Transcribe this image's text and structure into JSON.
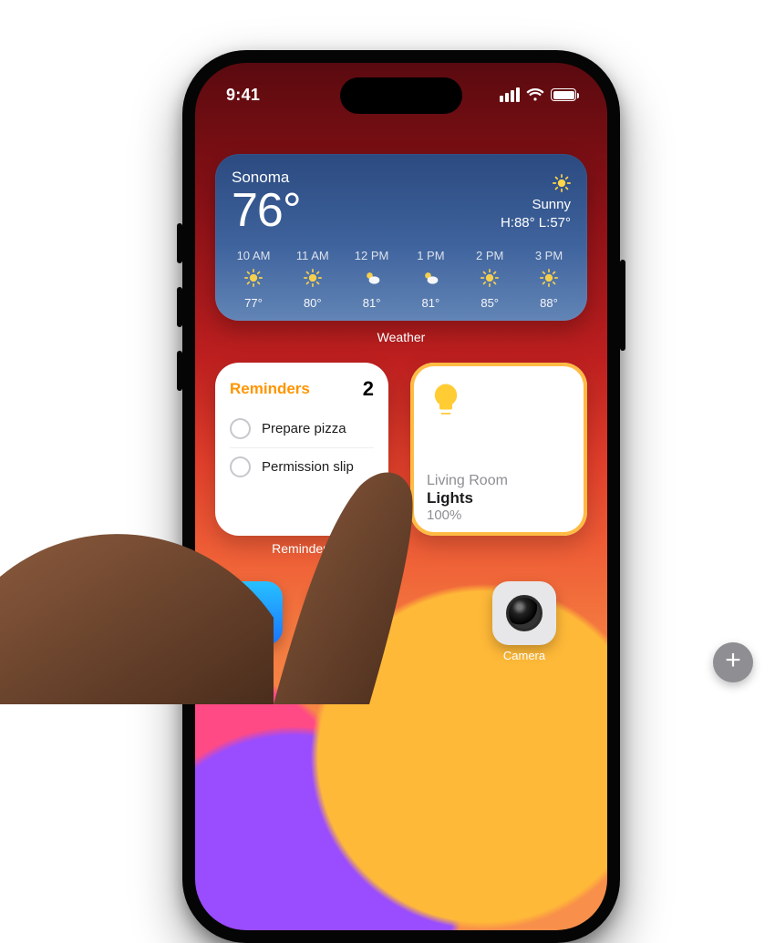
{
  "status": {
    "time": "9:41"
  },
  "weather": {
    "label": "Weather",
    "location": "Sonoma",
    "temp": "76°",
    "condition": "Sunny",
    "hilo": "H:88° L:57°",
    "hours": [
      {
        "t": "10 AM",
        "icon": "sun",
        "temp": "77°"
      },
      {
        "t": "11 AM",
        "icon": "sun",
        "temp": "80°"
      },
      {
        "t": "12 PM",
        "icon": "sun-cloud",
        "temp": "81°"
      },
      {
        "t": "1 PM",
        "icon": "sun-cloud",
        "temp": "81°"
      },
      {
        "t": "2 PM",
        "icon": "sun",
        "temp": "85°"
      },
      {
        "t": "3 PM",
        "icon": "sun",
        "temp": "88°"
      }
    ]
  },
  "reminders": {
    "label": "Reminders",
    "title": "Reminders",
    "count": "2",
    "items": [
      {
        "text": "Prepare pizza"
      },
      {
        "text": "Permission slip"
      }
    ]
  },
  "home": {
    "room": "Living Room",
    "device": "Lights",
    "percent": "100%"
  },
  "apps": {
    "camera_label": "Camera"
  }
}
